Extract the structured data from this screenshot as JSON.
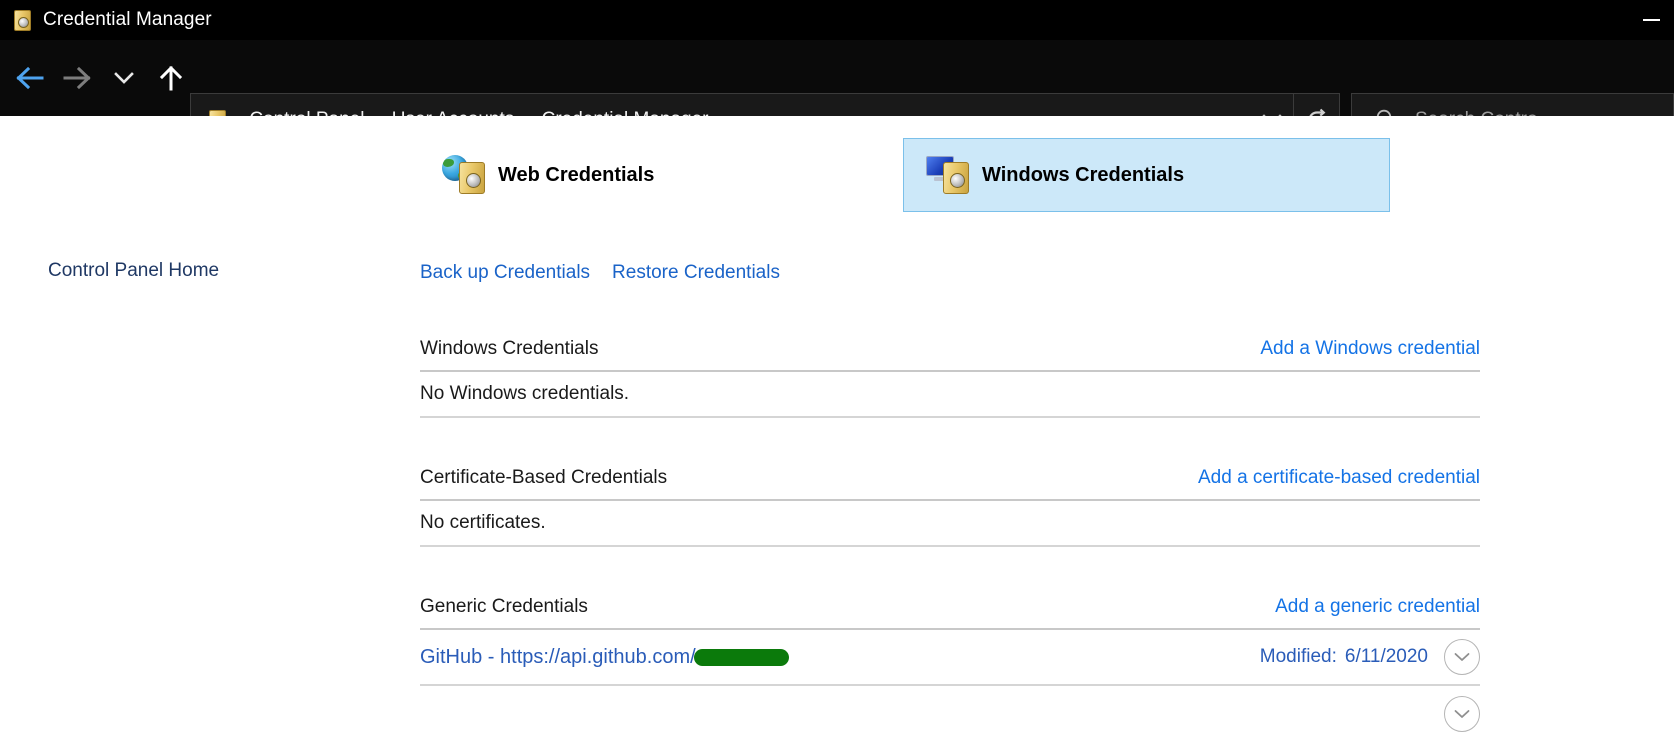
{
  "window": {
    "title": "Credential Manager",
    "icon": "vault-icon",
    "minimize_label": "Minimize"
  },
  "nav": {
    "back": "Back",
    "forward": "Forward",
    "recent": "Recent locations",
    "up": "Up one level",
    "breadcrumb": {
      "icon": "vault-icon",
      "separator": "›",
      "items": [
        {
          "label": "Control Panel"
        },
        {
          "label": "User Accounts"
        },
        {
          "label": "Credential Manager"
        }
      ]
    },
    "address_dropdown": "Previous locations",
    "refresh": "Refresh"
  },
  "search": {
    "icon": "search-icon",
    "placeholder": "Search Contro"
  },
  "sidebar": {
    "home_link": "Control Panel Home"
  },
  "tabs": [
    {
      "label": "Web Credentials",
      "icon": "globe-vault-icon",
      "selected": false
    },
    {
      "label": "Windows Credentials",
      "icon": "monitor-vault-icon",
      "selected": true
    }
  ],
  "actions": [
    {
      "label": "Back up Credentials"
    },
    {
      "label": "Restore Credentials"
    }
  ],
  "sections": [
    {
      "title": "Windows Credentials",
      "add_link": "Add a Windows credential",
      "empty_text": "No Windows credentials."
    },
    {
      "title": "Certificate-Based Credentials",
      "add_link": "Add a certificate-based credential",
      "empty_text": "No certificates."
    },
    {
      "title": "Generic Credentials",
      "add_link": "Add a generic credential"
    }
  ],
  "credentials": [
    {
      "name": "GitHub - https://api.github.com/",
      "redacted": true,
      "modified_label": "Modified:",
      "modified_date": "6/11/2020",
      "expander_icon": "chevron-down-icon"
    }
  ],
  "colors": {
    "link_blue": "#1473e6",
    "cred_blue": "#2a5cb8",
    "sidebar_blue": "#1f3864",
    "tab_selected_bg": "#cce8f9",
    "tab_selected_border": "#7bc0ea",
    "redaction_green": "#0b7a0b",
    "chrome_black": "#000000"
  }
}
